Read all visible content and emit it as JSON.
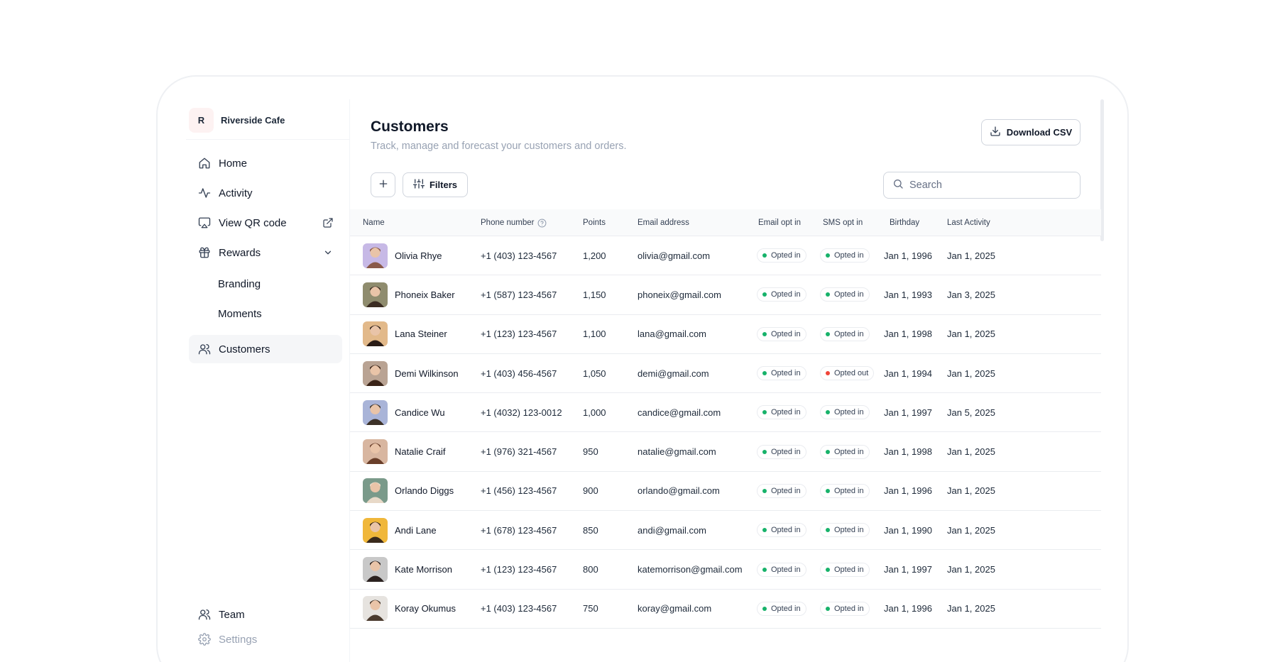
{
  "brand": {
    "initial": "R",
    "name": "Riverside Cafe"
  },
  "nav": {
    "home": "Home",
    "activity": "Activity",
    "qr": "View QR code",
    "rewards": "Rewards",
    "branding": "Branding",
    "moments": "Moments",
    "customers": "Customers",
    "team": "Team",
    "settings": "Settings"
  },
  "page": {
    "title": "Customers",
    "subtitle": "Track, manage and forecast your customers and orders.",
    "download_label": "Download CSV",
    "filters_label": "Filters",
    "search_placeholder": "Search"
  },
  "table": {
    "columns": [
      "Name",
      "Phone number",
      "Points",
      "Email address",
      "Email opt in",
      "SMS opt in",
      "Birthday",
      "Last Activity"
    ],
    "rows": [
      {
        "name": "Olivia Rhye",
        "phone": "+1 (403) 123-4567",
        "points": "1,200",
        "email": "olivia@gmail.com",
        "email_opt": "Opted in",
        "sms_opt": "Opted in",
        "birthday": "Jan 1, 1996",
        "last": "Jan 1, 2025",
        "avatar_bg": "#c7b9e6",
        "avatar_fg": "#8a5a4a"
      },
      {
        "name": "Phoneix Baker",
        "phone": "+1 (587) 123-4567",
        "points": "1,150",
        "email": "phoneix@gmail.com",
        "email_opt": "Opted in",
        "sms_opt": "Opted in",
        "birthday": "Jan 1, 1993",
        "last": "Jan 3, 2025",
        "avatar_bg": "#8f8c6e",
        "avatar_fg": "#3b2c22"
      },
      {
        "name": "Lana Steiner",
        "phone": "+1 (123) 123-4567",
        "points": "1,100",
        "email": "lana@gmail.com",
        "email_opt": "Opted in",
        "sms_opt": "Opted in",
        "birthday": "Jan 1, 1998",
        "last": "Jan 1, 2025",
        "avatar_bg": "#e2b98a",
        "avatar_fg": "#2a1c16"
      },
      {
        "name": "Demi Wilkinson",
        "phone": "+1 (403) 456-4567",
        "points": "1,050",
        "email": "demi@gmail.com",
        "email_opt": "Opted in",
        "sms_opt": "Opted out",
        "birthday": "Jan 1, 1994",
        "last": "Jan 1, 2025",
        "avatar_bg": "#b9a393",
        "avatar_fg": "#3a2418"
      },
      {
        "name": "Candice Wu",
        "phone": "+1 (4032) 123-0012",
        "points": "1,000",
        "email": "candice@gmail.com",
        "email_opt": "Opted in",
        "sms_opt": "Opted in",
        "birthday": "Jan 1, 1997",
        "last": "Jan 5, 2025",
        "avatar_bg": "#a9b4d8",
        "avatar_fg": "#3d3229"
      },
      {
        "name": "Natalie Craif",
        "phone": "+1 (976) 321-4567",
        "points": "950",
        "email": "natalie@gmail.com",
        "email_opt": "Opted in",
        "sms_opt": "Opted in",
        "birthday": "Jan 1, 1998",
        "last": "Jan 1, 2025",
        "avatar_bg": "#d8b6a0",
        "avatar_fg": "#6a3f2a"
      },
      {
        "name": "Orlando Diggs",
        "phone": "+1 (456) 123-4567",
        "points": "900",
        "email": "orlando@gmail.com",
        "email_opt": "Opted in",
        "sms_opt": "Opted in",
        "birthday": "Jan 1, 1996",
        "last": "Jan 1, 2025",
        "avatar_bg": "#7a9a8a",
        "avatar_fg": "#e8d9c8"
      },
      {
        "name": "Andi Lane",
        "phone": "+1 (678) 123-4567",
        "points": "850",
        "email": "andi@gmail.com",
        "email_opt": "Opted in",
        "sms_opt": "Opted in",
        "birthday": "Jan 1, 1990",
        "last": "Jan 1, 2025",
        "avatar_bg": "#f0b73a",
        "avatar_fg": "#3a2a1c"
      },
      {
        "name": "Kate Morrison",
        "phone": "+1 (123) 123-4567",
        "points": "800",
        "email": "katemorrison@gmail.com",
        "email_opt": "Opted in",
        "sms_opt": "Opted in",
        "birthday": "Jan 1, 1997",
        "last": "Jan 1, 2025",
        "avatar_bg": "#c8c8c8",
        "avatar_fg": "#2b2220"
      },
      {
        "name": "Koray Okumus",
        "phone": "+1 (403) 123-4567",
        "points": "750",
        "email": "koray@gmail.com",
        "email_opt": "Opted in",
        "sms_opt": "Opted in",
        "birthday": "Jan 1, 1996",
        "last": "Jan 1, 2025",
        "avatar_bg": "#e6e3df",
        "avatar_fg": "#4a3a2e"
      }
    ]
  },
  "colors": {
    "opted_in": "#17b26a",
    "opted_out": "#f04438",
    "active_bg": "#f5f6f8"
  }
}
